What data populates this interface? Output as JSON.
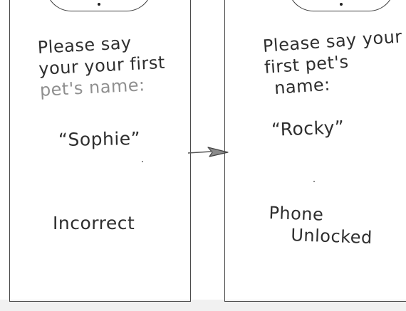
{
  "screens": [
    {
      "prompt_lines": [
        "Please say",
        "your your first",
        "pet's name:"
      ],
      "answer": "“Sophie”",
      "result": "Incorrect"
    },
    {
      "prompt_lines": [
        "Please say your",
        "first pet's",
        "name:"
      ],
      "answer": "“Rocky”",
      "result_lines": [
        "Phone",
        "Unlocked"
      ]
    }
  ],
  "transition": {
    "icon": "arrow-right-icon"
  },
  "colors": {
    "ink": "#2e2e2e",
    "faint_ink": "#8f8f8f",
    "arrow_fill": "#8a8a8a",
    "paper": "#ffffff"
  }
}
